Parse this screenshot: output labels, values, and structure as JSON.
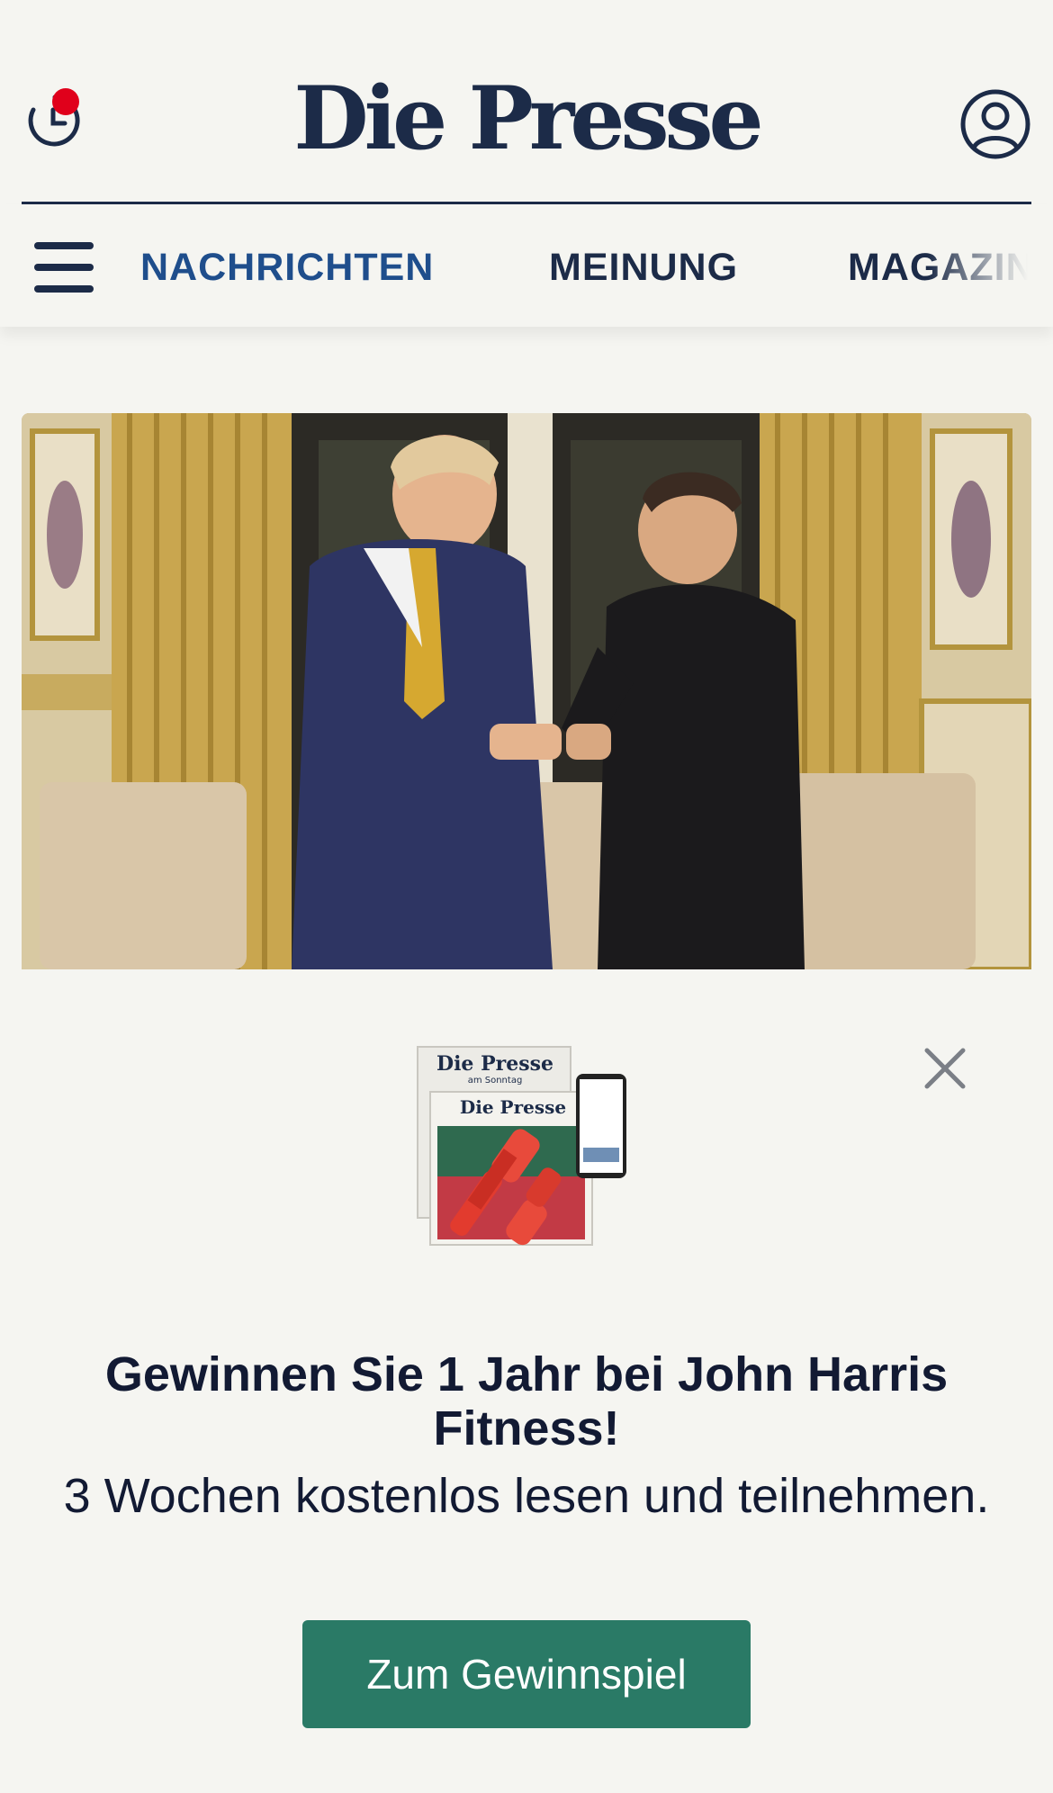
{
  "header": {
    "logo": "Die Presse",
    "icons": {
      "history": "history-clock-icon",
      "account": "account-icon"
    },
    "notification_color": "#e0001b"
  },
  "nav": {
    "items": [
      {
        "label": "NACHRICHTEN",
        "active": true
      },
      {
        "label": "MEINUNG",
        "active": false
      },
      {
        "label": "MAGAZIN",
        "active": false
      }
    ]
  },
  "promo": {
    "image_labels": {
      "paper_sunday": "Die Presse",
      "sunday_sub": "am Sonntag",
      "paper": "Die Presse"
    },
    "title": "Gewinnen Sie 1 Jahr bei John Harris Fitness!",
    "subtitle": "3 Wochen kostenlos lesen und teilnehmen.",
    "cta_label": "Zum Gewinnspiel",
    "cta_color": "#2a7a66"
  },
  "colors": {
    "brand": "#1c2b48",
    "nav_active": "#1f4e8c",
    "background": "#f5f5f1"
  }
}
